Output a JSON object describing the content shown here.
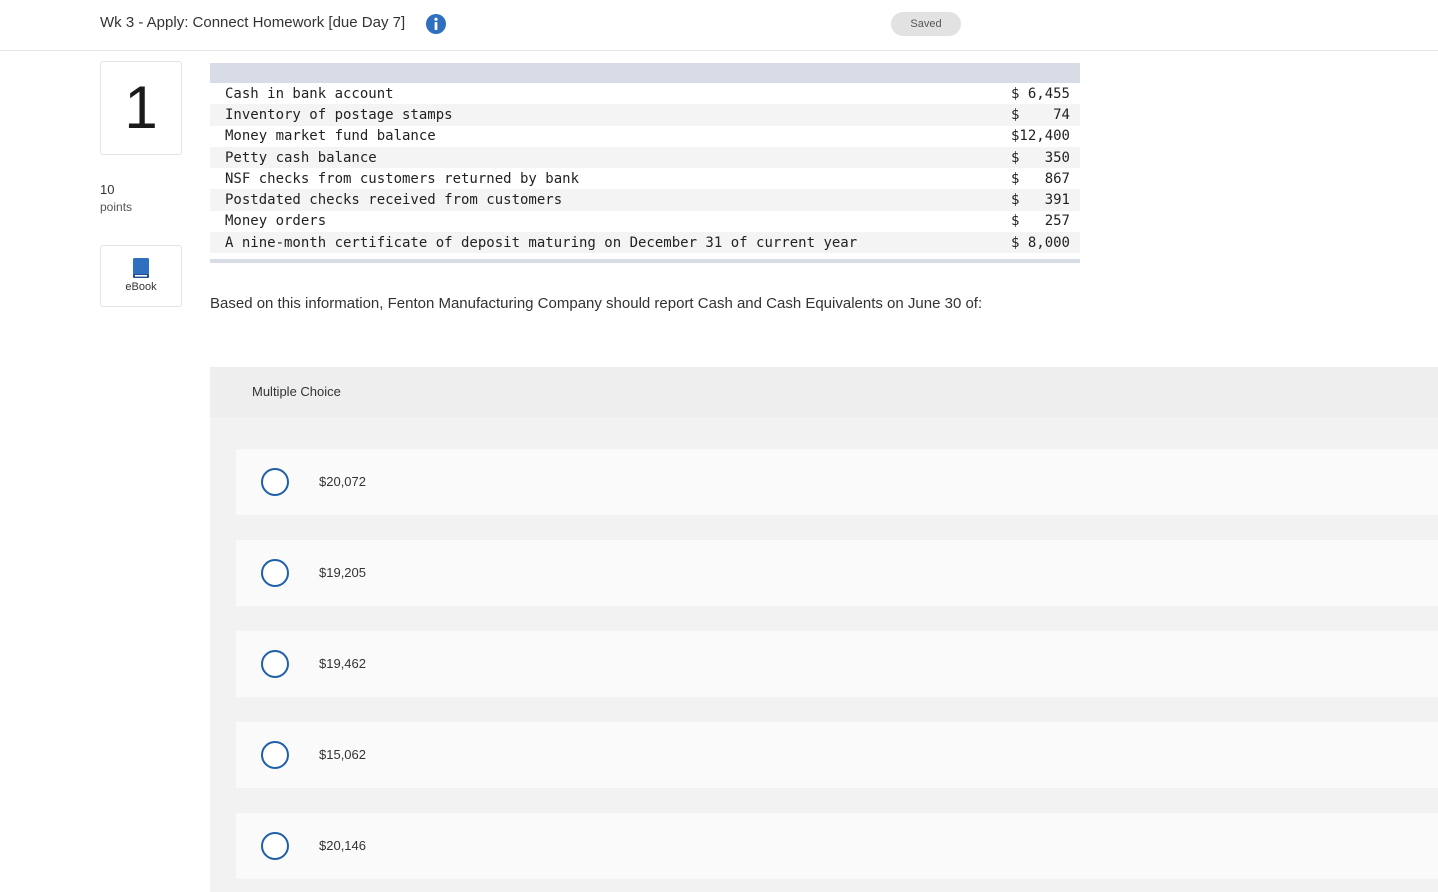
{
  "header": {
    "title": "Wk 3 - Apply: Connect Homework [due Day 7]",
    "status": "Saved"
  },
  "question": {
    "number": "1",
    "points_value": "10",
    "points_label": "points",
    "ebook_label": "eBook",
    "prompt": "Based on this information, Fenton Manufacturing Company should report Cash and Cash Equivalents on June 30 of:"
  },
  "table": {
    "rows": [
      {
        "label": "Cash in bank account",
        "amount": "$ 6,455"
      },
      {
        "label": "Inventory of postage stamps",
        "amount": "$    74"
      },
      {
        "label": "Money market fund balance",
        "amount": "$12,400"
      },
      {
        "label": "Petty cash balance",
        "amount": "$   350"
      },
      {
        "label": "NSF checks from customers returned by bank",
        "amount": "$   867"
      },
      {
        "label": "Postdated checks received from customers",
        "amount": "$   391"
      },
      {
        "label": "Money orders",
        "amount": "$   257"
      },
      {
        "label": "A nine-month certificate of deposit maturing on December 31 of current year",
        "amount": "$ 8,000"
      }
    ]
  },
  "multiple_choice": {
    "header": "Multiple Choice",
    "options": [
      {
        "label": "$20,072"
      },
      {
        "label": "$19,205"
      },
      {
        "label": "$19,462"
      },
      {
        "label": "$15,062"
      },
      {
        "label": "$20,146"
      }
    ]
  },
  "colors": {
    "accent": "#1f5fa8",
    "info_icon": "#2f6fc0",
    "table_bar": "#d7dce6"
  },
  "icons": {
    "info": "info-circle-icon",
    "ebook": "book-icon"
  }
}
